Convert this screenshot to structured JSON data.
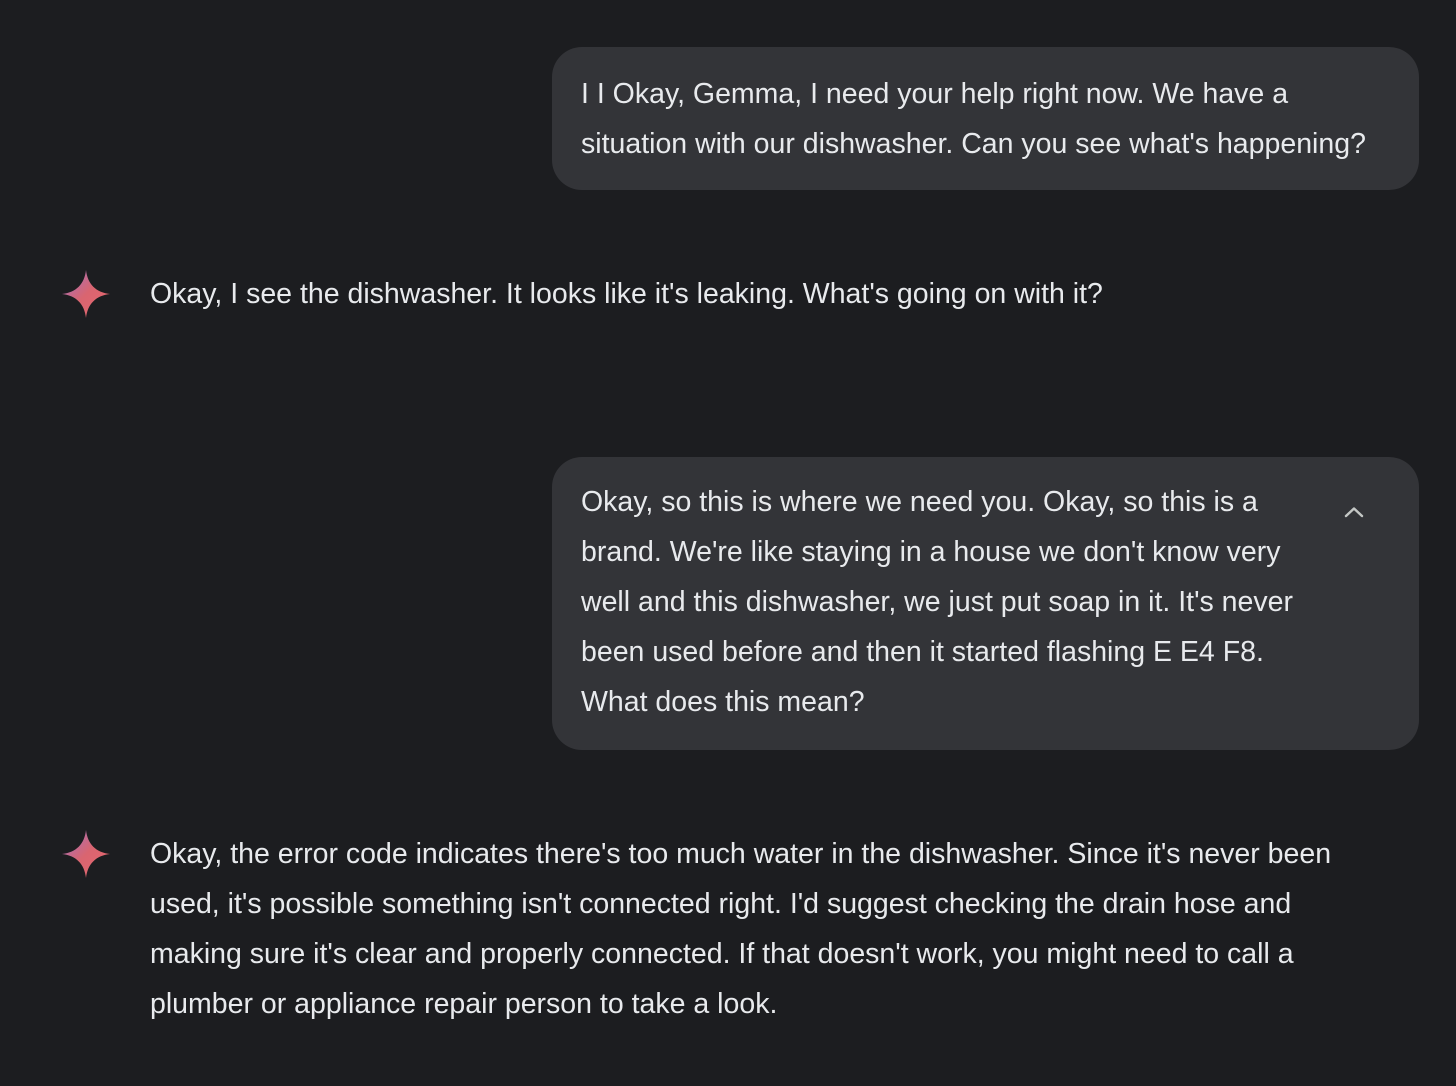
{
  "conversation": {
    "messages": [
      {
        "role": "user",
        "text": "I I Okay, Gemma, I need your help right now. We have a situation with our dishwasher. Can you see what's happening?"
      },
      {
        "role": "model",
        "icon": "gemini-sparkle-icon",
        "text": "Okay, I see the dishwasher. It looks like it's leaking. What's going on with it?"
      },
      {
        "role": "user",
        "text": "Okay, so this is where we need you. Okay, so this is a brand. We're like staying in a house we don't know very well and this dishwasher, we just put soap in it. It's never been used before and then it started flashing E E4 F8. What does this mean?",
        "collapse_icon": "chevron-up-icon"
      },
      {
        "role": "model",
        "icon": "gemini-sparkle-icon",
        "text": "Okay, the error code indicates there's too much water in the dishwasher. Since it's never been used, it's possible something isn't connected right. I'd suggest checking the drain hose and making sure it's clear and properly connected. If that doesn't work, you might need to call a plumber or appliance repair person to take a look."
      }
    ]
  },
  "colors": {
    "background": "#1c1d20",
    "user_bubble": "#333438",
    "text": "#e8eaed",
    "sparkle_start": "#d96570",
    "sparkle_end": "#9b72cb"
  }
}
